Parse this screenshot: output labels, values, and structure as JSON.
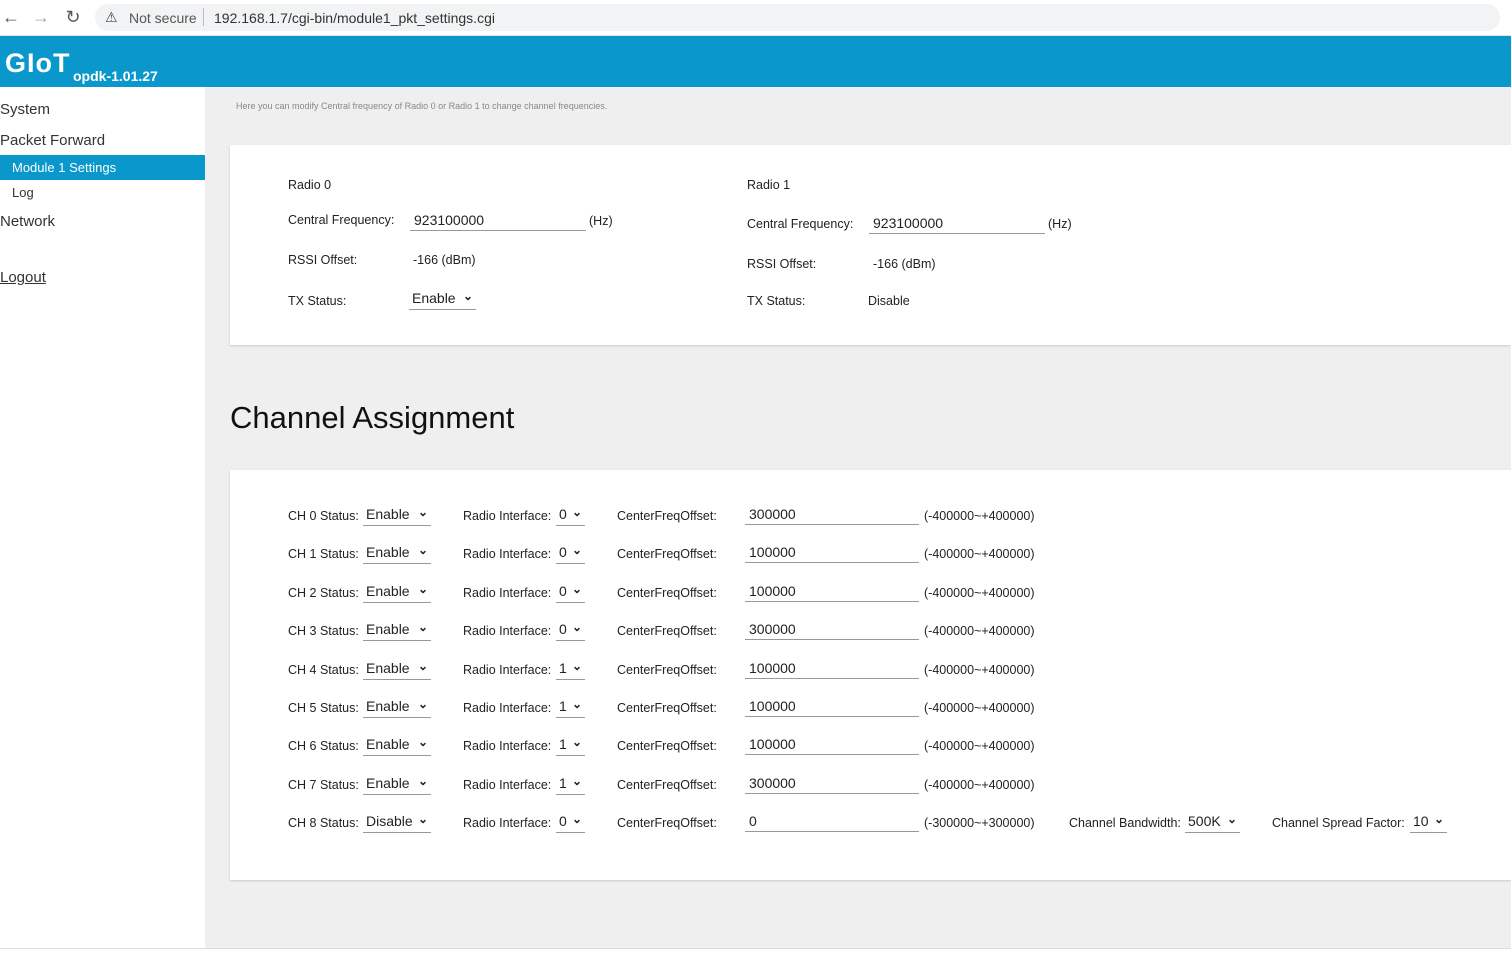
{
  "browser": {
    "not_secure": "Not secure",
    "url": "192.168.1.7/cgi-bin/module1_pkt_settings.cgi"
  },
  "header": {
    "logo": "GIoT",
    "version": "opdk-1.01.27"
  },
  "sidebar": {
    "items": [
      {
        "label": "System"
      },
      {
        "label": "Packet Forward"
      },
      {
        "label": "Module 1 Settings"
      },
      {
        "label": "Log"
      },
      {
        "label": "Network"
      },
      {
        "label": "Logout"
      }
    ]
  },
  "main": {
    "hint": "Here you can modify Central frequency of Radio 0 or Radio 1 to change channel frequencies.",
    "radio0": {
      "title": "Radio 0",
      "freq_label": "Central Frequency:",
      "freq_value": "923100000",
      "freq_unit": "(Hz)",
      "rssi_label": "RSSI Offset:",
      "rssi_value": "-166 (dBm)",
      "tx_label": "TX Status:",
      "tx_value": "Enable"
    },
    "radio1": {
      "title": "Radio 1",
      "freq_label": "Central Frequency:",
      "freq_value": "923100000",
      "freq_unit": "(Hz)",
      "rssi_label": "RSSI Offset:",
      "rssi_value": "-166 (dBm)",
      "tx_label": "TX Status:",
      "tx_value": "Disable"
    },
    "channel_title": "Channel Assignment",
    "radio_if_label": "Radio Interface:",
    "offset_label": "CenterFreqOffset:",
    "channels": [
      {
        "status_label": "CH 0 Status:",
        "status": "Enable",
        "radio": "0",
        "offset": "300000",
        "range": "(-400000~+400000)"
      },
      {
        "status_label": "CH 1 Status:",
        "status": "Enable",
        "radio": "0",
        "offset": "100000",
        "range": "(-400000~+400000)"
      },
      {
        "status_label": "CH 2 Status:",
        "status": "Enable",
        "radio": "0",
        "offset": "100000",
        "range": "(-400000~+400000)"
      },
      {
        "status_label": "CH 3 Status:",
        "status": "Enable",
        "radio": "0",
        "offset": "300000",
        "range": "(-400000~+400000)"
      },
      {
        "status_label": "CH 4 Status:",
        "status": "Enable",
        "radio": "1",
        "offset": "100000",
        "range": "(-400000~+400000)"
      },
      {
        "status_label": "CH 5 Status:",
        "status": "Enable",
        "radio": "1",
        "offset": "100000",
        "range": "(-400000~+400000)"
      },
      {
        "status_label": "CH 6 Status:",
        "status": "Enable",
        "radio": "1",
        "offset": "100000",
        "range": "(-400000~+400000)"
      },
      {
        "status_label": "CH 7 Status:",
        "status": "Enable",
        "radio": "1",
        "offset": "300000",
        "range": "(-400000~+400000)"
      },
      {
        "status_label": "CH 8 Status:",
        "status": "Disable",
        "radio": "0",
        "offset": "0",
        "range": "(-300000~+300000)"
      }
    ],
    "ch8_extra": {
      "bw_label": "Channel Bandwidth:",
      "bw_value": "500K",
      "sf_label": "Channel Spread Factor:",
      "sf_value": "10"
    }
  },
  "colors": {
    "accent": "#0a97cc",
    "background": "#efefef"
  },
  "icons": [
    "back-arrow-icon",
    "forward-arrow-icon",
    "reload-icon",
    "warning-icon",
    "chevron-down-icon"
  ]
}
